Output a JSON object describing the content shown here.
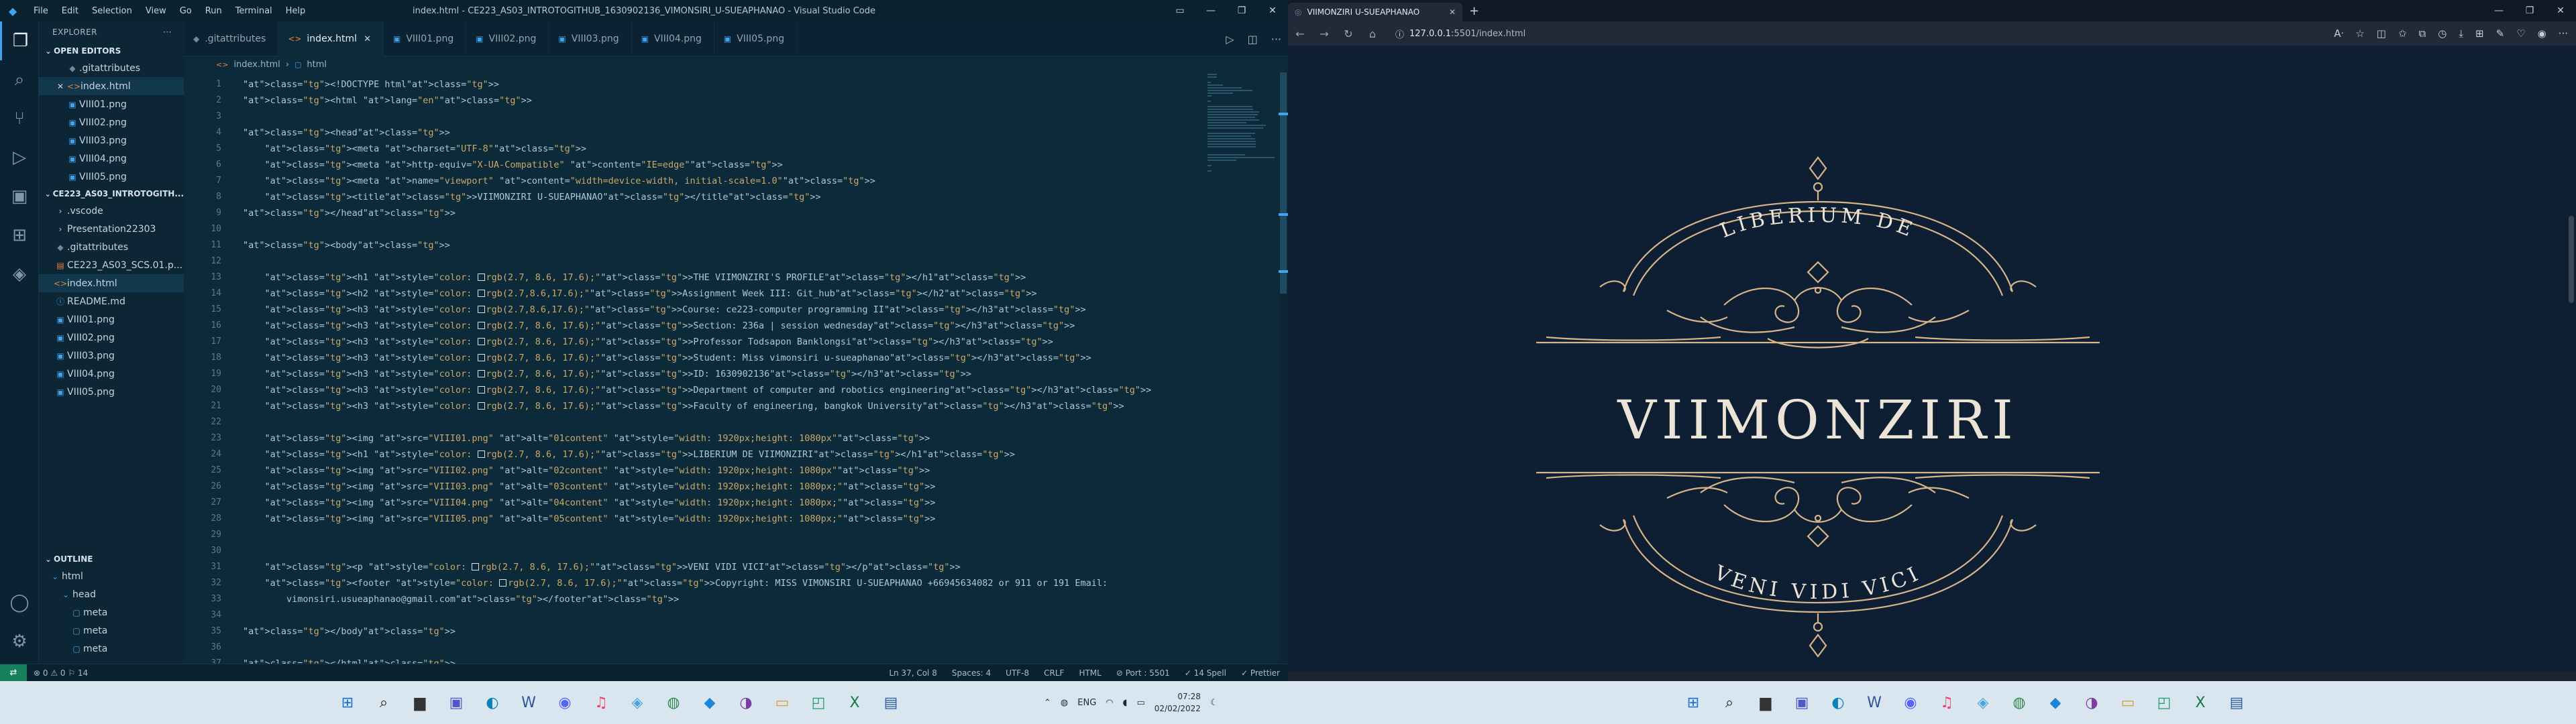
{
  "vscode": {
    "window_title": "index.html - CE223_AS03_INTROTOGITHUB_1630902136_VIMONSIRI_U-SUEAPHANAO - Visual Studio Code",
    "menu": [
      "File",
      "Edit",
      "Selection",
      "View",
      "Go",
      "Run",
      "Terminal",
      "Help"
    ],
    "explorer_title": "EXPLORER",
    "open_editors_label": "OPEN EDITORS",
    "open_editors": [
      ".gitattributes",
      "index.html",
      "VIII01.png",
      "VIII02.png",
      "VIII03.png",
      "VIII04.png",
      "VIII05.png"
    ],
    "project_label": "CE223_AS03_INTROTOGITH...",
    "project_files": [
      ".vscode",
      "Presentation22303",
      ".gitattributes",
      "CE223_AS03_SCS.01.p...",
      "index.html",
      "README.md",
      "VIII01.png",
      "VIII02.png",
      "VIII03.png",
      "VIII04.png",
      "VIII05.png"
    ],
    "outline_label": "OUTLINE",
    "outline_items": [
      "html",
      "head",
      "meta",
      "meta",
      "meta"
    ],
    "tabs": [
      ".gitattributes",
      "index.html",
      "VIII01.png",
      "VIII02.png",
      "VIII03.png",
      "VIII04.png",
      "VIII05.png"
    ],
    "breadcrumb": [
      "index.html",
      "html"
    ],
    "code_lines": [
      "<!DOCTYPE html>",
      "<html lang=\"en\">",
      "",
      "<head>",
      "    <meta charset=\"UTF-8\">",
      "    <meta http-equiv=\"X-UA-Compatible\" content=\"IE=edge\">",
      "    <meta name=\"viewport\" content=\"width=device-width, initial-scale=1.0\">",
      "    <title>VIIMONZIRI U-SUEAPHANAO</title>",
      "</head>",
      "",
      "<body>",
      "",
      "    <h1 style=\"color: ▢rgb(2.7, 8.6, 17.6);\">THE VIIMONZIRI'S PROFILE</h1>",
      "    <h2 style=\"color: ▢rgb(2.7,8.6,17.6);\">Assignment Week III: Git_hub</h2>",
      "    <h3 style=\"color: ▢rgb(2.7,8.6,17.6);\">Course: ce223-computer programming II</h3>",
      "    <h3 style=\"color: ▢rgb(2.7, 8.6, 17.6);\">Section: 236a | session wednesday</h3>",
      "    <h3 style=\"color: ▢rgb(2.7, 8.6, 17.6);\">Professor Todsapon Banklongsi</h3>",
      "    <h3 style=\"color: ▢rgb(2.7, 8.6, 17.6);\">Student: Miss vimonsiri u-sueaphanao</h3>",
      "    <h3 style=\"color: ▢rgb(2.7, 8.6, 17.6);\">ID: 1630902136</h3>",
      "    <h3 style=\"color: ▢rgb(2.7, 8.6, 17.6);\">Department of computer and robotics engineering</h3>",
      "    <h3 style=\"color: ▢rgb(2.7, 8.6, 17.6);\">Faculty of engineering, bangkok University</h3>",
      "",
      "    <img src=\"VIII01.png\" alt=\"01content\" style=\"width: 1920px;height: 1080px\">",
      "    <h1 style=\"color: ▢rgb(2.7, 8.6, 17.6);\">LIBERIUM DE VIIMONZIRI</h1>",
      "    <img src=\"VIII02.png\" alt=\"02content\" style=\"width: 1920px;height: 1080px\">",
      "    <img src=\"VIII03.png\" alt=\"03content\" style=\"width: 1920px;height: 1080px;\">",
      "    <img src=\"VIII04.png\" alt=\"04content\" style=\"width: 1920px;height: 1080px;\">",
      "    <img src=\"VIII05.png\" alt=\"05content\" style=\"width: 1920px;height: 1080px;\">",
      "",
      "",
      "    <p style=\"color: ▢rgb(2.7, 8.6, 17.6);\">VENI VIDI VICI</p>",
      "    <footer style=\"color: ▢rgb(2.7, 8.6, 17.6);\">Copyright: MISS VIMONSIRI U-SUEAPHANAO +66945634082 or 911 or 191 Email:",
      "        vimonsiri.usueaphanao@gmail.com</footer>",
      "",
      "</body>",
      "",
      "</html>"
    ],
    "status_left": "⊗ 0 ⚠ 0  ⚐ 14",
    "status_right": [
      "Ln 37, Col 8",
      "Spaces: 4",
      "UTF-8",
      "CRLF",
      "HTML",
      "⊘ Port : 5501",
      "✓ 14 Spell",
      "✓ Prettier"
    ]
  },
  "browser": {
    "tab_title": "VIIMONZIRI U-SUEAPHANAO",
    "url_host": "127.0.0.1",
    "url_path": ":5501/index.html",
    "emblem_top": "LIBERIUM DE",
    "emblem_title": "VIIMONZIRI",
    "emblem_bottom": "VENI VIDI VICI",
    "emblem_color": "#d7b58a",
    "page_bg": "#0e1f34"
  },
  "taskbar": {
    "lang": "ENG",
    "time": "07:28",
    "date": "02/02/2022"
  },
  "colors": {
    "accent": "#3ea4f0",
    "html_icon": "#e8833a",
    "status_remote": "#16825d"
  }
}
